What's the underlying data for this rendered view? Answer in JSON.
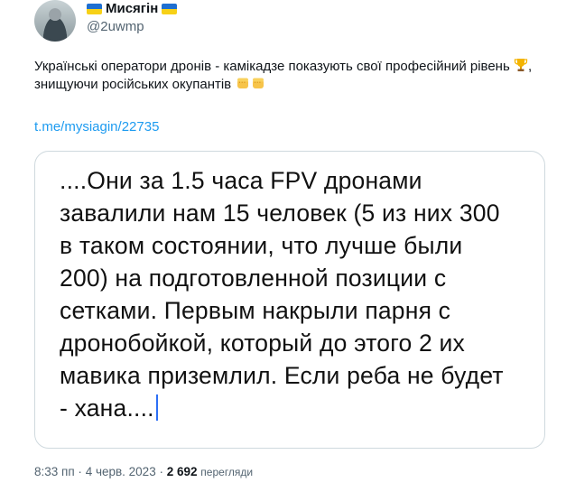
{
  "author": {
    "display_name": "Мисягін",
    "handle": "@2uwmp",
    "flag_colors": [
      "#1f6fd1",
      "#f7d117"
    ]
  },
  "tweet": {
    "text_part1": "Українські оператори дронів - камікадзе показують свої професійний рівень",
    "text_part2": ", знищуючи російських окупантів",
    "emojis": [
      "trophy-icon",
      "fist-icon",
      "fist-icon"
    ],
    "link": "t.me/mysiagin/22735"
  },
  "media": {
    "text": "....Они за 1.5 часа FPV дронами\nзавалили нам 15 человек (5 из них 300\nв таком состоянии, что лучше были\n200)  на подготовленной позиции с\nсетками. Первым накрыли парня с\nдронобойкой, который до этого 2 их\nмавика приземлил.  Если реба не будет\n- хана...."
  },
  "meta": {
    "time": "8:33 пп",
    "separator": "·",
    "date": "4 черв. 2023",
    "views_count": "2 692",
    "views_label": "перегляди"
  },
  "colors": {
    "link": "#1d9bf0",
    "secondary_text": "#536471",
    "border": "#cfd9de",
    "caret": "#2d6ff5"
  }
}
